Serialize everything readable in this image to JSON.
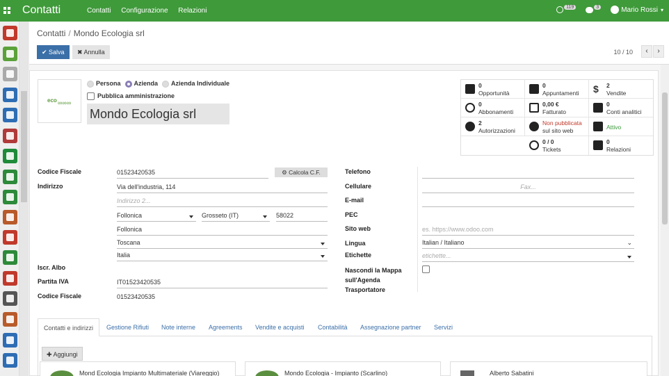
{
  "topbar": {
    "brand": "Contatti",
    "menu": [
      "Contatti",
      "Configurazione",
      "Relazioni"
    ],
    "activity_count": "119",
    "messages_count": "3",
    "user": "Mario Rossi"
  },
  "colors": {
    "brand_green": "#3f9a3a",
    "primary": "#3b6fa8"
  },
  "breadcrumb": {
    "parent": "Contatti",
    "current": "Mondo Ecologia srl"
  },
  "actions": {
    "save": "Salva",
    "cancel": "Annulla"
  },
  "pager": {
    "text": "10 / 10"
  },
  "company_type": {
    "person": "Persona",
    "company": "Azienda",
    "individual": "Azienda Individuale",
    "selected": "Azienda"
  },
  "public_admin": "Pubblica amministrazione",
  "logo_text": "eco",
  "name": "Mondo Ecologia srl",
  "smart_buttons": [
    {
      "v": "0",
      "l": "Opportunità",
      "icon": "star-icon"
    },
    {
      "v": "0",
      "l": "Appuntamenti",
      "icon": "calendar-icon"
    },
    {
      "v": "2",
      "l": "Vendite",
      "icon": "dollar-icon"
    },
    {
      "v": "0",
      "l": "Abbonamenti",
      "icon": "refresh-icon"
    },
    {
      "v": "0,00 €",
      "l": "Fatturato",
      "icon": "edit-icon"
    },
    {
      "v": "0",
      "l": "Conti analitici",
      "icon": "book-icon"
    },
    {
      "v": "2",
      "l": "Autorizzazioni",
      "icon": "gear-icon"
    },
    {
      "v": "Non pubblicata",
      "l": "sul sito web",
      "icon": "globe-icon"
    },
    {
      "v": "",
      "l": "Attivo",
      "icon": "archive-icon"
    },
    {
      "v": "0 / 0",
      "l": "Tickets",
      "icon": "lifebuoy-icon"
    },
    {
      "v": "0",
      "l": "Relazioni",
      "icon": "users-icon"
    }
  ],
  "left_fields": {
    "codice_fiscale_label": "Codice Fiscale",
    "codice_fiscale": "01523420535",
    "calc_btn": "Calcola C.F.",
    "indirizzo_label": "Indirizzo",
    "street": "Via dell'industria, 114",
    "street2_ph": "Indirizzo 2...",
    "city": "Follonica",
    "province": "Grosseto (IT)",
    "zip": "58022",
    "city2": "Follonica",
    "region": "Toscana",
    "country": "Italia",
    "iscr_albo_label": "Iscr. Albo",
    "piva_label": "Partita IVA",
    "piva": "IT01523420535",
    "cf2_label": "Codice Fiscale",
    "cf2": "01523420535"
  },
  "right_fields": {
    "telefono": "Telefono",
    "cellulare": "Cellulare",
    "fax_ph": "Fax...",
    "email": "E-mail",
    "pec": "PEC",
    "sito": "Sito web",
    "sito_ph": "es. https://www.odoo.com",
    "lingua": "Lingua",
    "lingua_val": "Italian / Italiano",
    "etichette": "Etichette",
    "etichette_ph": "etichette...",
    "nascondi": "Nascondi la Mappa sull'Agenda Trasportatore"
  },
  "tabs": [
    "Contatti e indirizzi",
    "Gestione Rifiuti",
    "Note interne",
    "Agreements",
    "Vendite e acquisti",
    "Contabilità",
    "Assegnazione partner",
    "Servizi"
  ],
  "tab_body": {
    "add": "Aggiungi",
    "cards": [
      "Mond Ecologia Impianto Multimateriale (Viareggio)",
      "Mondo Ecologia - Impianto (Scarlino)",
      "Alberto Sabatini"
    ]
  }
}
